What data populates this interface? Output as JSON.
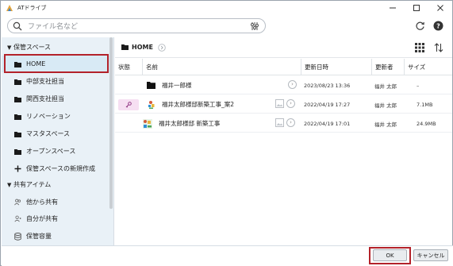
{
  "window": {
    "title": "ATドライブ"
  },
  "search": {
    "placeholder": "ファイル名など"
  },
  "sidebar": {
    "sections": [
      {
        "label": "保管スペース",
        "items": [
          {
            "label": "HOME",
            "icon": "folder-icon",
            "selected": true
          },
          {
            "label": "中部支社担当",
            "icon": "folder-icon"
          },
          {
            "label": "関西支社担当",
            "icon": "folder-icon"
          },
          {
            "label": "リノベーション",
            "icon": "folder-icon"
          },
          {
            "label": "マスタスペース",
            "icon": "folder-icon"
          },
          {
            "label": "オープンスペース",
            "icon": "folder-icon"
          },
          {
            "label": "保管スペースの新規作成",
            "icon": "plus-icon"
          }
        ]
      },
      {
        "label": "共有アイテム",
        "items": [
          {
            "label": "他から共有",
            "icon": "users-icon"
          },
          {
            "label": "自分が共有",
            "icon": "user-share-icon"
          }
        ]
      }
    ],
    "storage_label": "保管容量"
  },
  "main": {
    "breadcrumb": "HOME",
    "columns": [
      "状態",
      "名前",
      "更新日時",
      "更新者",
      "サイズ"
    ],
    "rows": [
      {
        "status": "",
        "icon": "folder-icon",
        "name": "福井一郎様",
        "updated": "2023/08/23 13:36",
        "updater": "福井 太郎",
        "size": "–"
      },
      {
        "status": "key-icon",
        "icon": "document-icon",
        "name": "福井太郎様邸新築工事_案2",
        "updated": "2022/04/19 17:27",
        "updater": "福井 太郎",
        "size": "7.1MB"
      },
      {
        "status": "",
        "icon": "document-icon",
        "name": "福井太郎様邸 新築工事",
        "updated": "2022/04/19 17:01",
        "updater": "福井 太郎",
        "size": "24.9MB"
      }
    ]
  },
  "footer": {
    "ok_label": "OK",
    "cancel_label": "キャンセル"
  },
  "colors": {
    "highlight": "#b3222a",
    "sidebar_bg": "#e9f1f7",
    "status_pill": "#f6dff2"
  }
}
